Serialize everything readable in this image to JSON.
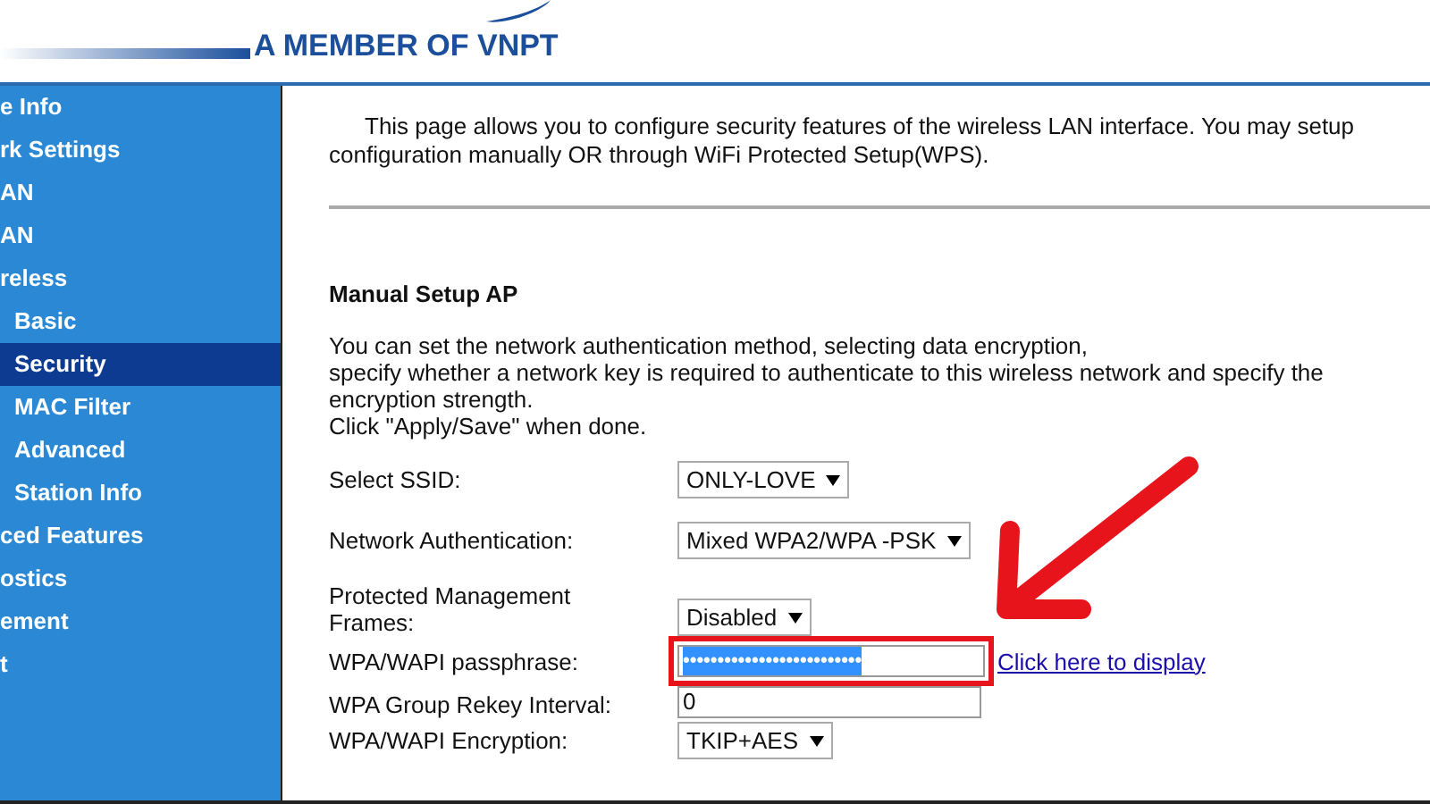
{
  "header": {
    "tagline": "A MEMBER OF VNPT"
  },
  "sidebar": {
    "items": [
      {
        "label": "e Info",
        "selected": false
      },
      {
        "label": "rk Settings",
        "selected": false
      },
      {
        "label": "AN",
        "selected": false
      },
      {
        "label": "AN",
        "selected": false
      },
      {
        "label": "reless",
        "selected": false,
        "children": [
          {
            "label": "Basic",
            "selected": false
          },
          {
            "label": "Security",
            "selected": true
          },
          {
            "label": "MAC Filter",
            "selected": false
          },
          {
            "label": "Advanced",
            "selected": false
          },
          {
            "label": "Station Info",
            "selected": false
          }
        ]
      },
      {
        "label": "ced Features",
        "selected": false
      },
      {
        "label": "ostics",
        "selected": false
      },
      {
        "label": "ement",
        "selected": false
      },
      {
        "label": "t",
        "selected": false
      }
    ]
  },
  "intro": "This page allows you to configure security features of the wireless LAN interface. You may setup configuration manually OR through WiFi Protected Setup(WPS).",
  "section_title": "Manual Setup AP",
  "description": [
    "You can set the network authentication method, selecting data encryption,",
    "specify whether a network key is required to authenticate to this wireless network and specify the encryption strength.",
    "Click \"Apply/Save\" when done."
  ],
  "fields": [
    {
      "kind": "select",
      "label": "Select SSID:",
      "value": "ONLY-LOVE"
    },
    {
      "kind": "select",
      "label": "Network Authentication:",
      "value": "Mixed WPA2/WPA -PSK"
    },
    {
      "kind": "select",
      "label": "Protected Management Frames:",
      "value": "Disabled"
    },
    {
      "kind": "password",
      "label": "WPA/WAPI passphrase:",
      "value": "••••••••••••••••••••••••••",
      "selected": true,
      "highlighted": true,
      "link": "Click here to display"
    },
    {
      "kind": "text",
      "label": "WPA Group Rekey Interval:",
      "value": "0"
    },
    {
      "kind": "select",
      "label": "WPA/WAPI Encryption:",
      "value": "TKIP+AES"
    }
  ],
  "annotation": {
    "arrow": true
  }
}
